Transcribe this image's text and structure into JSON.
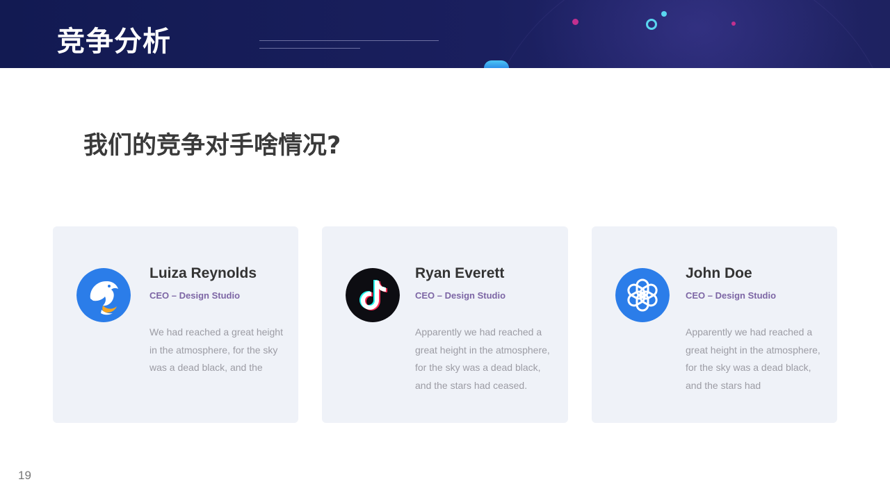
{
  "slide": {
    "title": "竞争分析",
    "question": "我们的竞争对手啥情况?",
    "page_number": "19"
  },
  "colors": {
    "header_background": "#1a1f5e",
    "card_background": "#eff2f8",
    "role_text": "#7d66a5",
    "accent_magenta": "#c2308f",
    "accent_cyan": "#5ad6f0"
  },
  "cards": [
    {
      "logo_icon": "dolphin-logo-icon",
      "name": "Luiza Reynolds",
      "role": "CEO – Design  Studio",
      "description": "We had reached a great height in the atmosphere, for the sky was  a dead black, and the"
    },
    {
      "logo_icon": "tiktok-logo-icon",
      "name": "Ryan Everett",
      "role": "CEO – Design  Studio",
      "description": "Apparently we  had reached a great height in the atmosphere, for the sky was  a dead black, and the stars had ceased."
    },
    {
      "logo_icon": "openai-logo-icon",
      "name": "John Doe",
      "role": "CEO – Design  Studio",
      "description": "Apparently we  had reached a great height in the atmosphere, for the sky was  a dead black, and the stars had"
    }
  ]
}
